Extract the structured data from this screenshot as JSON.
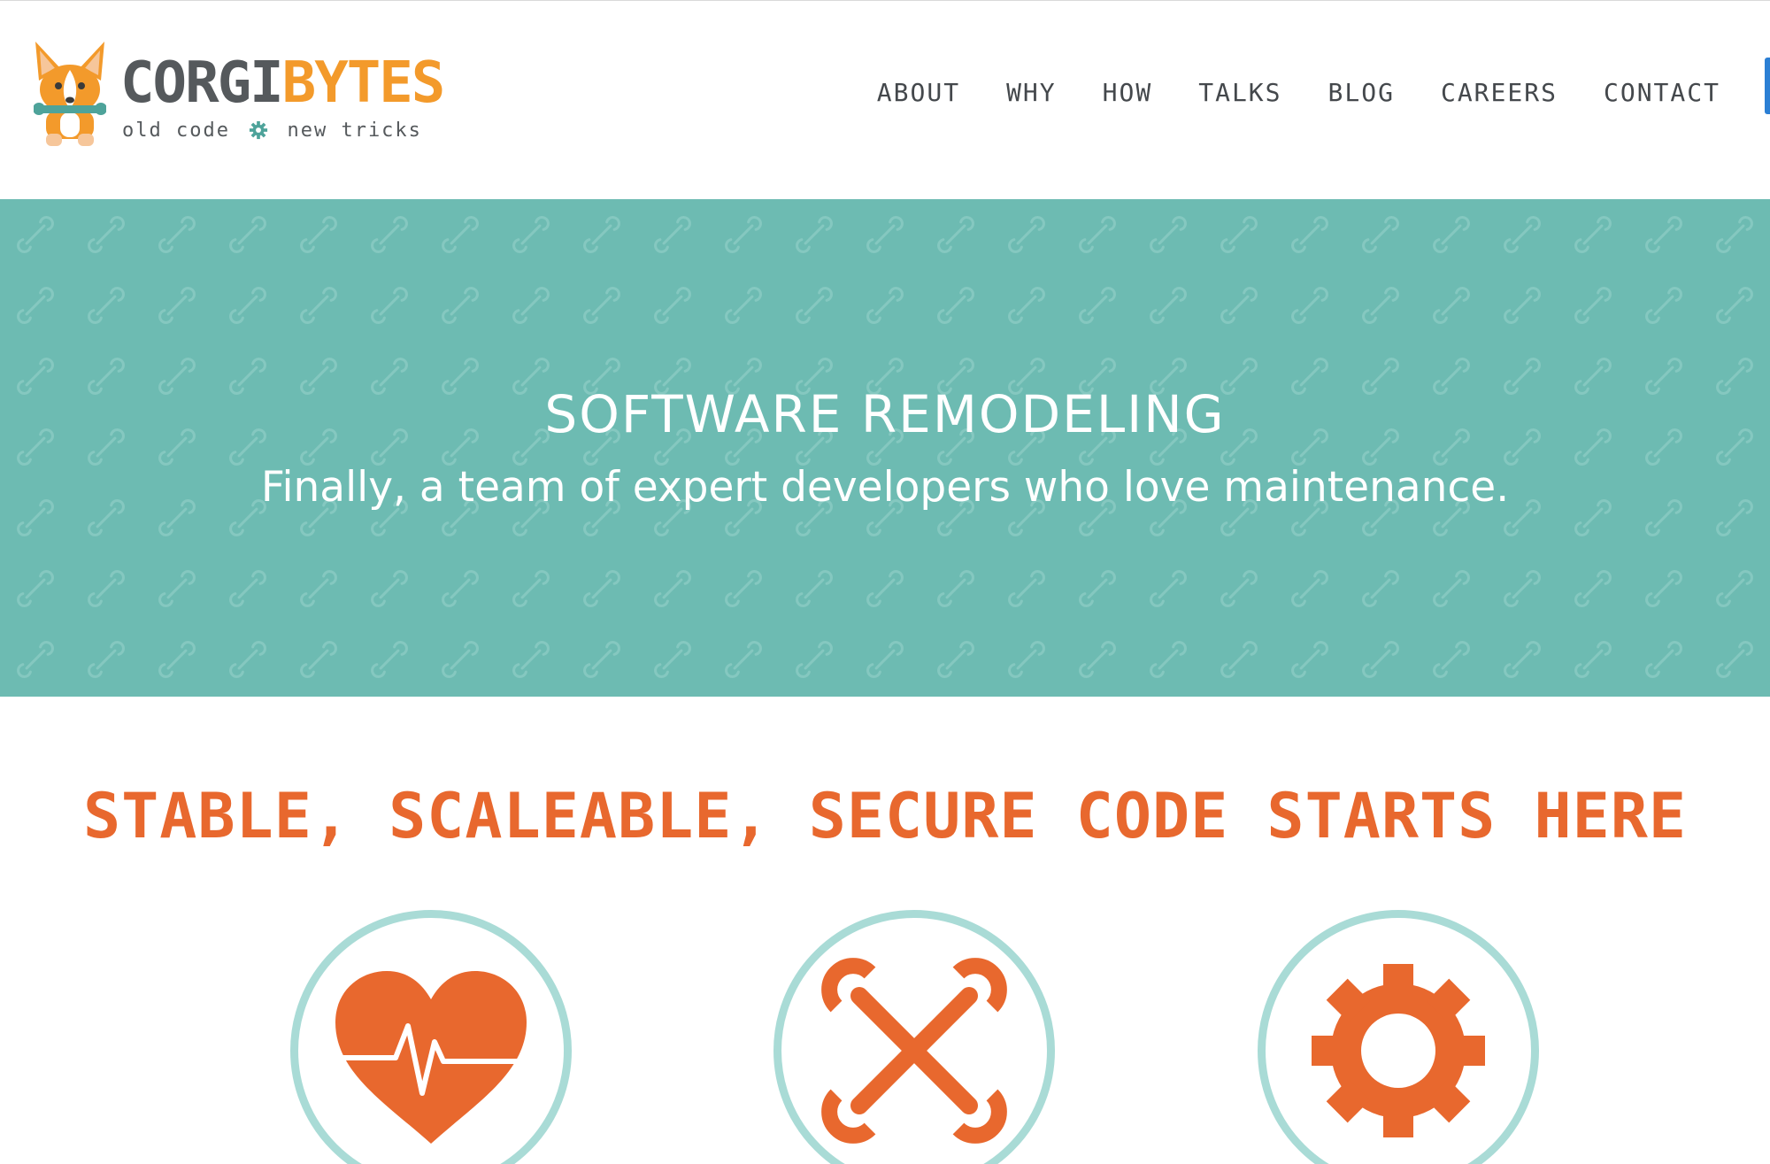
{
  "header": {
    "brand_part1": "CORGI",
    "brand_part2": "BYTES",
    "tagline_left": "old code",
    "tagline_right": "new tricks",
    "logo_icon": "corgi-with-wrench",
    "tagline_icon": "gear-icon"
  },
  "nav": {
    "items": [
      {
        "label": "ABOUT"
      },
      {
        "label": "WHY"
      },
      {
        "label": "HOW"
      },
      {
        "label": "TALKS"
      },
      {
        "label": "BLOG"
      },
      {
        "label": "CAREERS"
      },
      {
        "label": "CONTACT"
      }
    ]
  },
  "hero": {
    "title": "SOFTWARE REMODELING",
    "subtitle": "Finally, a team of expert developers who love maintenance.",
    "background_color": "#6dbbb2",
    "pattern_icon": "wrench-icon"
  },
  "features": {
    "title": "STABLE, SCALEABLE, SECURE CODE STARTS HERE",
    "icons": [
      {
        "name": "heartbeat-icon"
      },
      {
        "name": "crossed-wrenches-icon"
      },
      {
        "name": "gear-icon"
      }
    ]
  },
  "colors": {
    "accent_orange": "#e8682e",
    "brand_orange": "#f39a2b",
    "teal": "#6dbbb2",
    "teal_light": "#a9dbd6",
    "text_gray": "#55595c"
  }
}
